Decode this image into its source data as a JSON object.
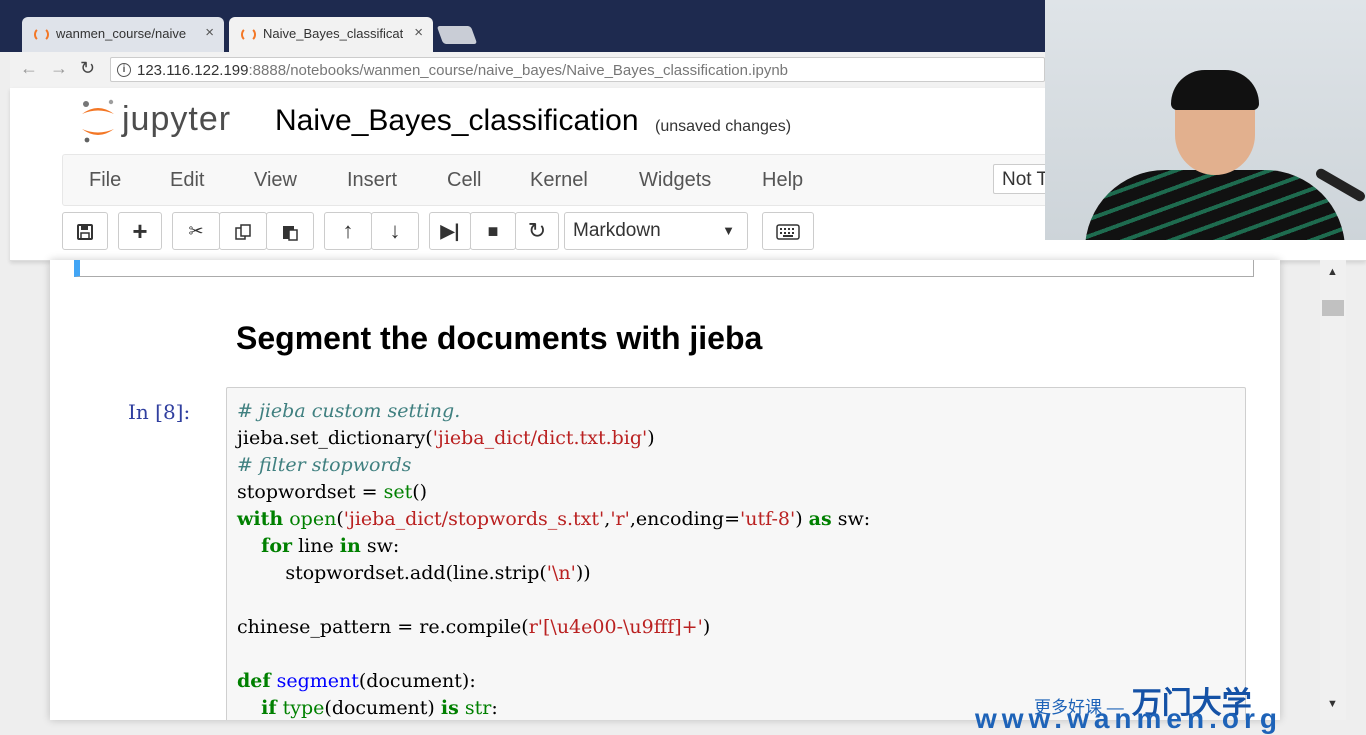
{
  "browser": {
    "tabs": [
      {
        "title": "wanmen_course/naive",
        "active": false
      },
      {
        "title": "Naive_Bayes_classificat",
        "active": true
      }
    ],
    "url_host": "123.116.122.199",
    "url_rest": ":8888/notebooks/wanmen_course/naive_bayes/Naive_Bayes_classification.ipynb"
  },
  "jupyter": {
    "logo_text": "jupyter",
    "notebook_title": "Naive_Bayes_classification",
    "save_status": "(unsaved changes)",
    "menu": [
      "File",
      "Edit",
      "View",
      "Insert",
      "Cell",
      "Kernel",
      "Widgets",
      "Help"
    ],
    "trust_status": "Not Trusted",
    "cell_type": "Markdown"
  },
  "notebook": {
    "heading": "Segment the documents with jieba",
    "prompt": "In  [8]:"
  },
  "watermark": {
    "prefix": "更多好课 —",
    "brand": "万门大学",
    "site": "www.wanmen.org"
  }
}
